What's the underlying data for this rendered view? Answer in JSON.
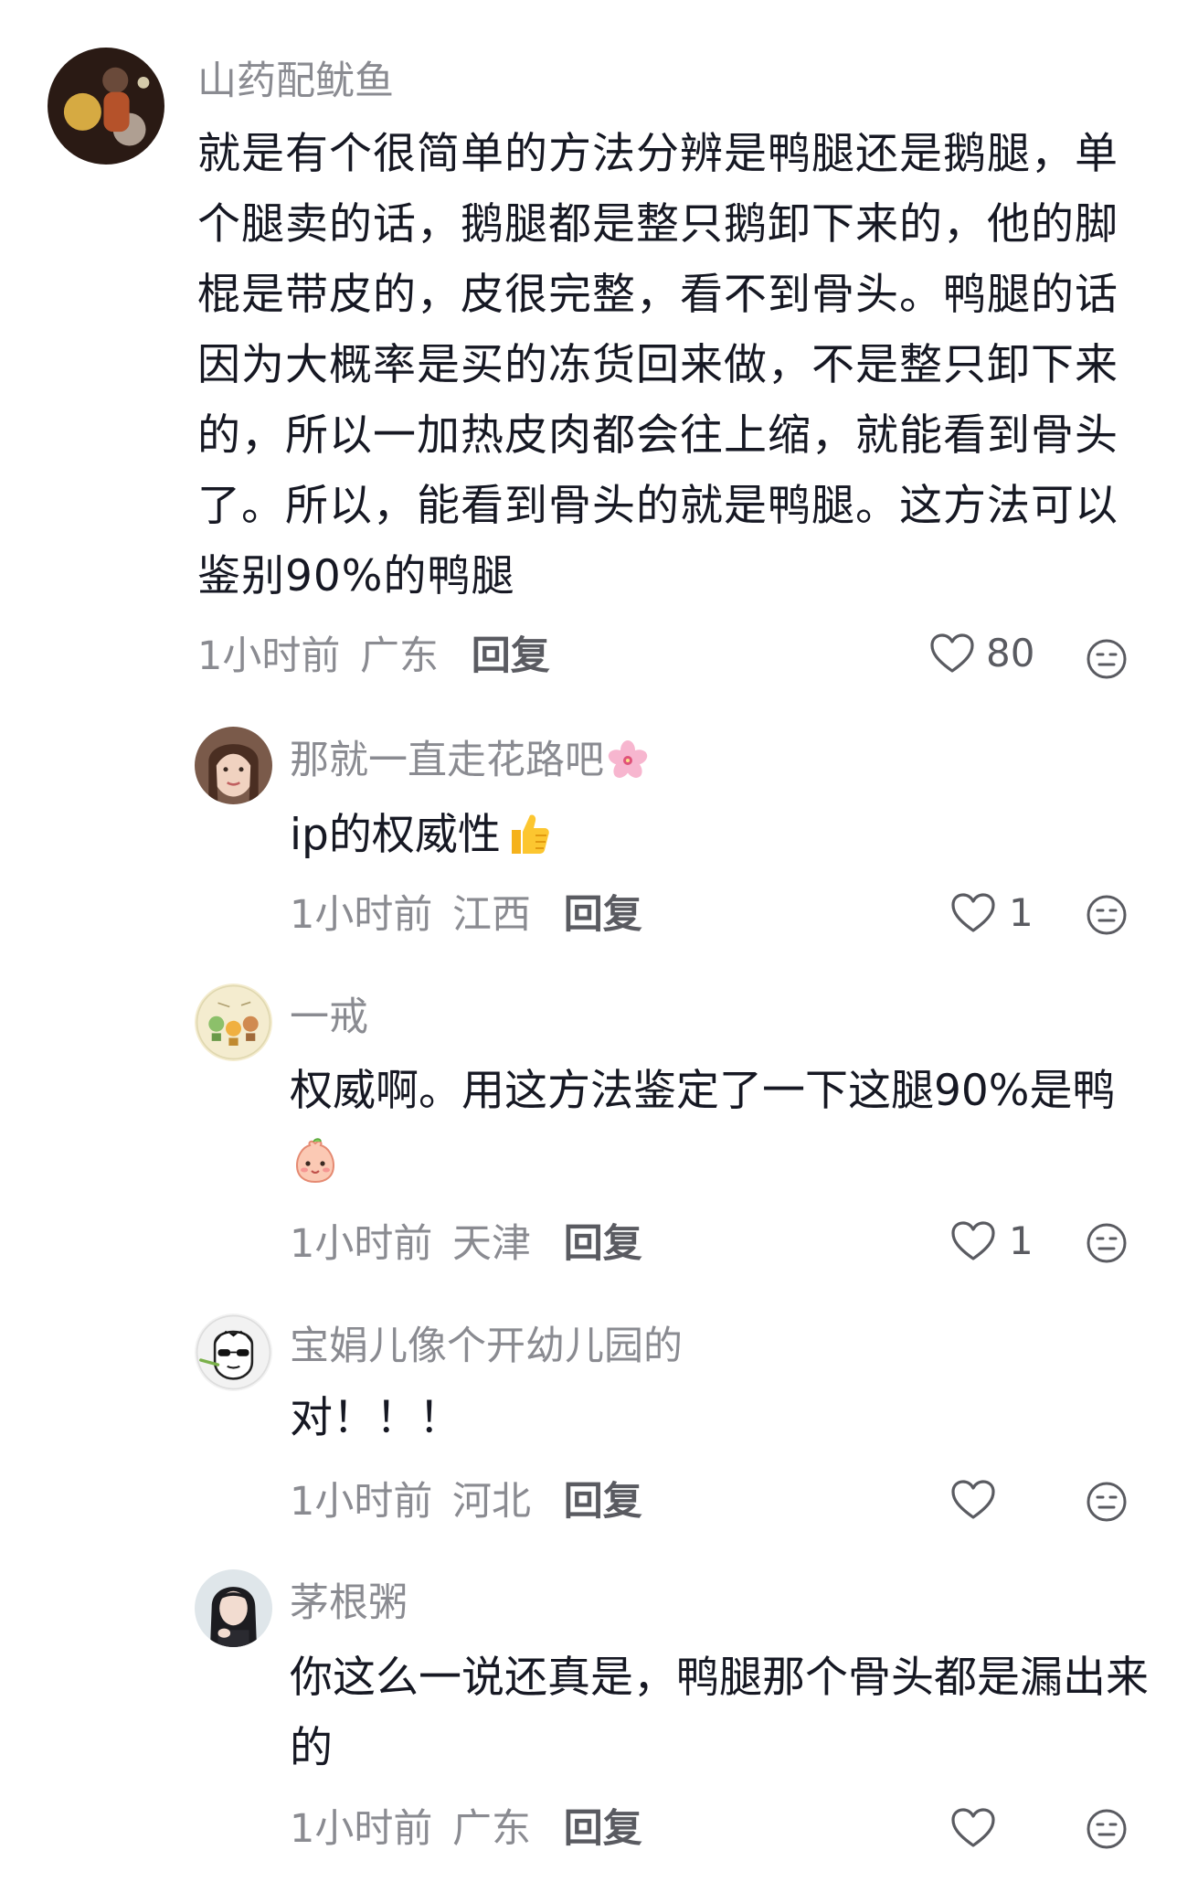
{
  "comments": [
    {
      "username": "山药配鱿鱼",
      "text": "就是有个很简单的方法分辨是鸭腿还是鹅腿，单个腿卖的话，鹅腿都是整只鹅卸下来的，他的脚棍是带皮的，皮很完整，看不到骨头。鸭腿的话因为大概率是买的冻货回来做，不是整只卸下来的，所以一加热皮肉都会往上缩，就能看到骨头了。所以，能看到骨头的就是鸭腿。这方法可以鉴别90%的鸭腿",
      "time": "1小时前",
      "location": "广东",
      "reply_label": "回复",
      "likes": "80"
    },
    {
      "username": "那就一直走花路吧",
      "username_emoji": "cherry-blossom-emoji",
      "text": "ip的权威性",
      "text_emoji": "thumbs-up-emoji",
      "time": "1小时前",
      "location": "江西",
      "reply_label": "回复",
      "likes": "1"
    },
    {
      "username": "一戒",
      "text": "权威啊。用这方法鉴定了一下这腿90%是鸭",
      "text_emoji": "blush-face-emoji",
      "time": "1小时前",
      "location": "天津",
      "reply_label": "回复",
      "likes": "1"
    },
    {
      "username": "宝娟儿像个开幼儿园的",
      "text": "对！！！",
      "time": "1小时前",
      "location": "河北",
      "reply_label": "回复",
      "likes": ""
    },
    {
      "username": "茅根粥",
      "text": "你这么一说还真是，鸭腿那个骨头都是漏出来的",
      "time": "1小时前",
      "location": "广东",
      "reply_label": "回复",
      "likes": ""
    }
  ],
  "icons": {
    "like": "heart-outline-icon",
    "opinion": "meh-face-icon"
  }
}
